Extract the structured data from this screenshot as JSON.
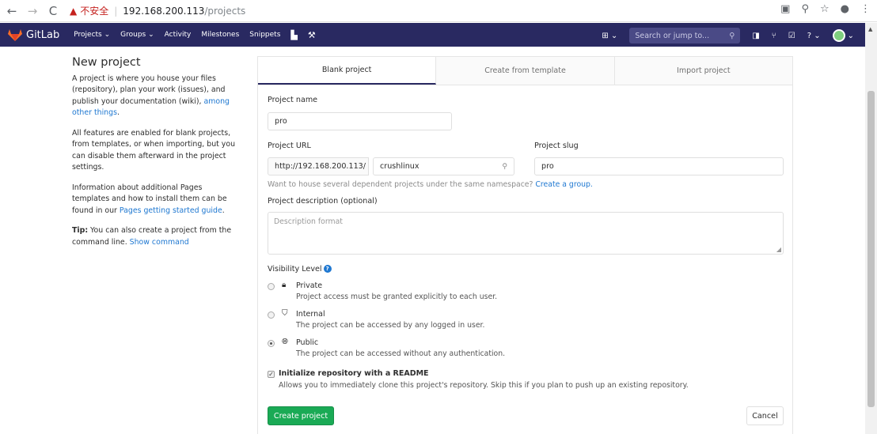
{
  "browser": {
    "back_icon": "arrow-left-icon",
    "forward_icon": "arrow-right-icon",
    "reload_icon": "reload-icon",
    "security_label": "不安全",
    "host": "192.168.200.113",
    "path": "/projects"
  },
  "nav": {
    "brand": "GitLab",
    "items": [
      "Projects ⌄",
      "Groups ⌄",
      "Activity",
      "Milestones",
      "Snippets"
    ],
    "search_placeholder": "Search or jump to...",
    "colors": {
      "bar": "#292961",
      "search": "#4a4a86"
    }
  },
  "sidebar": {
    "title": "New project",
    "p1_text": "A project is where you house your files (repository), plan your work (issues), and publish your documentation (wiki), ",
    "p1_link": "among other things",
    "p1_end": ".",
    "p2": "All features are enabled for blank projects, from templates, or when importing, but you can disable them afterward in the project settings.",
    "p3_text": "Information about additional Pages templates and how to install them can be found in our ",
    "p3_link": "Pages getting started guide",
    "p3_end": ".",
    "tip_bold": "Tip:",
    "tip_text": " You can also create a project from the command line. ",
    "tip_link": "Show command"
  },
  "tabs": [
    "Blank project",
    "Create from template",
    "Import project"
  ],
  "form": {
    "project_name_label": "Project name",
    "project_name_value": "pro",
    "project_url_label": "Project URL",
    "url_prefix": "http://192.168.200.113/",
    "namespace_value": "crushlinux",
    "project_slug_label": "Project slug",
    "slug_value": "pro",
    "group_help_text": "Want to house several dependent projects under the same namespace? ",
    "group_help_link": "Create a group.",
    "description_label": "Project description (optional)",
    "description_placeholder": "Description format",
    "visibility_label": "Visibility Level",
    "visibility_options": [
      {
        "title": "Private",
        "desc": "Project access must be granted explicitly to each user.",
        "icon": "lock-icon",
        "selected": false
      },
      {
        "title": "Internal",
        "desc": "The project can be accessed by any logged in user.",
        "icon": "shield-icon",
        "selected": false
      },
      {
        "title": "Public",
        "desc": "The project can be accessed without any authentication.",
        "icon": "globe-icon",
        "selected": true
      }
    ],
    "readme_label": "Initialize repository with a README",
    "readme_desc": "Allows you to immediately clone this project's repository. Skip this if you plan to push up an existing repository.",
    "readme_checked": true,
    "create_button": "Create project",
    "cancel_button": "Cancel",
    "colors": {
      "create": "#1aaa55",
      "link": "#1f78d1"
    }
  }
}
